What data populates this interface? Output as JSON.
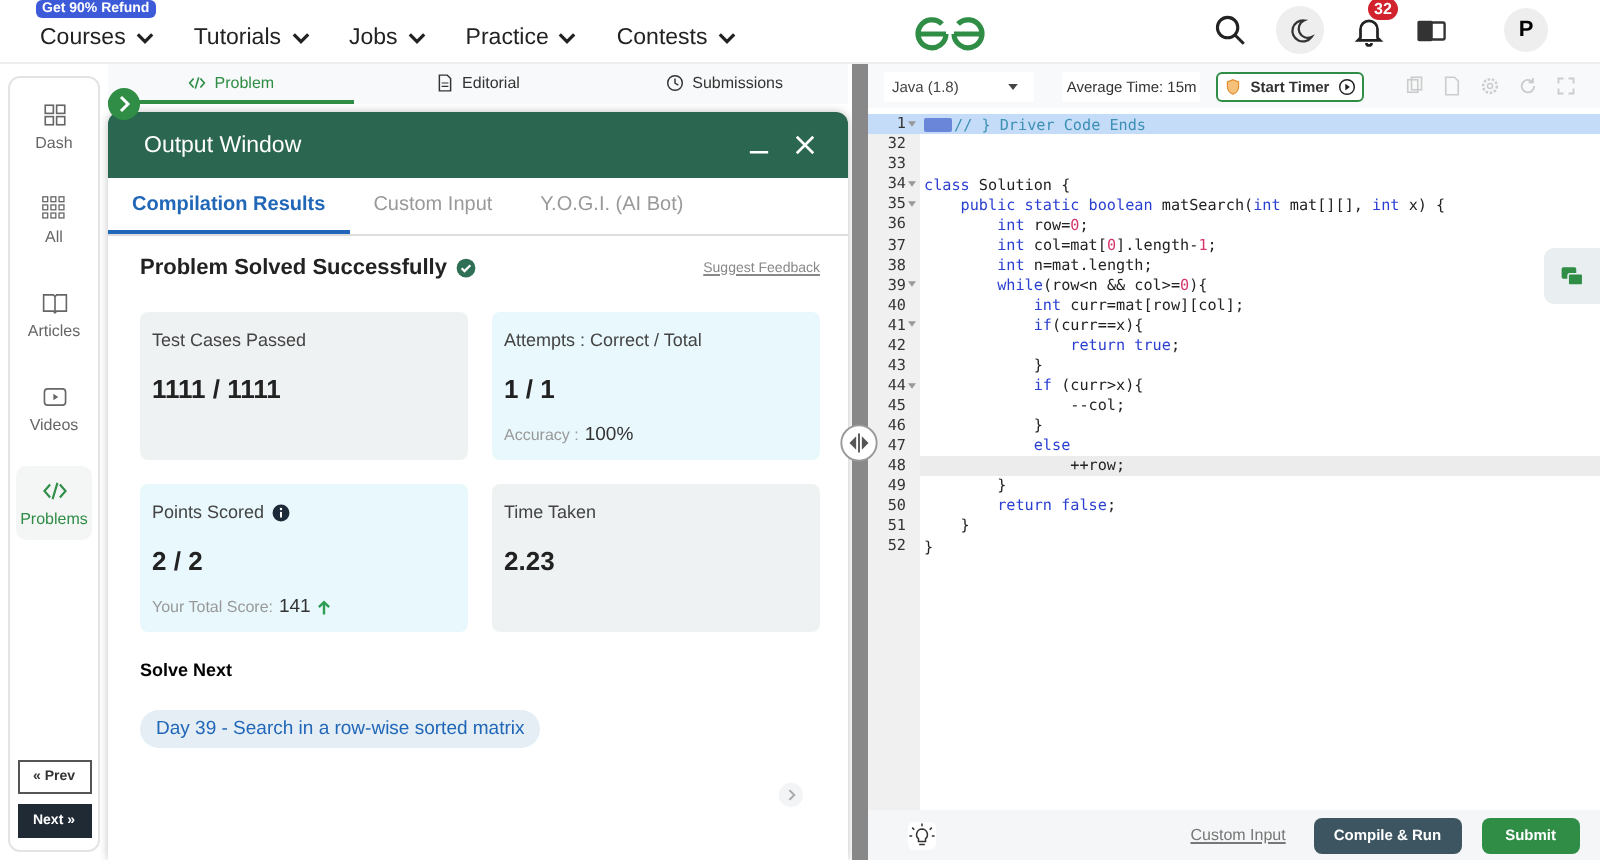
{
  "nav": {
    "promo_badge": "Get 90% Refund",
    "menu": [
      {
        "label": "Courses"
      },
      {
        "label": "Tutorials"
      },
      {
        "label": "Jobs"
      },
      {
        "label": "Practice"
      },
      {
        "label": "Contests"
      }
    ],
    "notification_count": "32",
    "avatar_letter": "P"
  },
  "sidebar": {
    "items": [
      {
        "label": "Dash",
        "selected": false
      },
      {
        "label": "All",
        "selected": false
      },
      {
        "label": "Articles",
        "selected": false
      },
      {
        "label": "Videos",
        "selected": false
      },
      {
        "label": "Problems",
        "selected": true
      }
    ],
    "prev": "« Prev",
    "next": "Next »"
  },
  "problem_tabs": [
    {
      "label": "Problem",
      "selected": true
    },
    {
      "label": "Editorial",
      "selected": false
    },
    {
      "label": "Submissions",
      "selected": false
    }
  ],
  "output_window": {
    "title": "Output Window",
    "tabs": [
      {
        "label": "Compilation Results",
        "selected": true
      },
      {
        "label": "Custom Input",
        "selected": false
      },
      {
        "label": "Y.O.G.I. (AI Bot)",
        "selected": false
      }
    ],
    "status": "Problem Solved Successfully",
    "feedback_link": "Suggest Feedback",
    "cards": [
      {
        "title": "Test Cases Passed",
        "value": "1111 / 1111",
        "color": "#eef2f2"
      },
      {
        "title": "Attempts : Correct / Total",
        "value": "1 / 1",
        "color": "#e8f8fc",
        "note_label": "Accuracy :",
        "note_value": "100%"
      },
      {
        "title": "Points Scored",
        "value": "2 / 2",
        "color": "#e8f8fc",
        "info_icon": true,
        "note_label": "Your Total Score:",
        "note_value": "141",
        "rising": true
      },
      {
        "title": "Time Taken",
        "value": "2.23",
        "color": "#eef2f2"
      }
    ],
    "solve_next_heading": "Solve Next",
    "solve_next": [
      "Day 39 - Search in a row-wise sorted matrix"
    ]
  },
  "editor": {
    "language": "Java (1.8)",
    "average_time": "Average Time: 15m",
    "timer_button": "Start Timer",
    "lines": [
      {
        "number": "1",
        "foldable": true,
        "selected": true,
        "folded": true,
        "segments": [
          {
            "kind": "comment",
            "text": "// } Driver Code Ends"
          }
        ]
      },
      {
        "number": "32",
        "foldable": false,
        "selected": false
      },
      {
        "number": "33",
        "foldable": false,
        "selected": false
      },
      {
        "number": "34",
        "foldable": true,
        "selected": false,
        "segments": [
          {
            "kind": "kw",
            "text": "class"
          },
          {
            "kind": "plain",
            "text": " Solution {"
          }
        ]
      },
      {
        "number": "35",
        "foldable": true,
        "selected": false,
        "segments": [
          {
            "kind": "kw",
            "text": "    public static boolean"
          },
          {
            "kind": "plain",
            "text": " matSearch("
          },
          {
            "kind": "kw",
            "text": "int"
          },
          {
            "kind": "plain",
            "text": " mat[][], "
          },
          {
            "kind": "kw",
            "text": "int"
          },
          {
            "kind": "plain",
            "text": " x) {"
          }
        ]
      },
      {
        "number": "36",
        "foldable": false,
        "selected": false,
        "segments": [
          {
            "kind": "kw",
            "text": "        int"
          },
          {
            "kind": "plain",
            "text": " row="
          },
          {
            "kind": "num",
            "text": "0"
          },
          {
            "kind": "plain",
            "text": ";"
          }
        ]
      },
      {
        "number": "37",
        "foldable": false,
        "selected": false,
        "segments": [
          {
            "kind": "kw",
            "text": "        int"
          },
          {
            "kind": "plain",
            "text": " col=mat["
          },
          {
            "kind": "num",
            "text": "0"
          },
          {
            "kind": "plain",
            "text": "].length-"
          },
          {
            "kind": "num",
            "text": "1"
          },
          {
            "kind": "plain",
            "text": ";"
          }
        ]
      },
      {
        "number": "38",
        "foldable": false,
        "selected": false,
        "segments": [
          {
            "kind": "kw",
            "text": "        int"
          },
          {
            "kind": "plain",
            "text": " n=mat.length;"
          }
        ]
      },
      {
        "number": "39",
        "foldable": true,
        "selected": false,
        "segments": [
          {
            "kind": "kw",
            "text": "        while"
          },
          {
            "kind": "plain",
            "text": "(row<n && col>="
          },
          {
            "kind": "num",
            "text": "0"
          },
          {
            "kind": "plain",
            "text": "){"
          }
        ]
      },
      {
        "number": "40",
        "foldable": false,
        "selected": false,
        "segments": [
          {
            "kind": "kw",
            "text": "            int"
          },
          {
            "kind": "plain",
            "text": " curr=mat[row][col];"
          }
        ]
      },
      {
        "number": "41",
        "foldable": true,
        "selected": false,
        "segments": [
          {
            "kind": "kw",
            "text": "            if"
          },
          {
            "kind": "plain",
            "text": "(curr==x){"
          }
        ]
      },
      {
        "number": "42",
        "foldable": false,
        "selected": false,
        "segments": [
          {
            "kind": "kw",
            "text": "                return true"
          },
          {
            "kind": "plain",
            "text": ";"
          }
        ]
      },
      {
        "number": "43",
        "foldable": false,
        "selected": false,
        "segments": [
          {
            "kind": "plain",
            "text": "            }"
          }
        ]
      },
      {
        "number": "44",
        "foldable": true,
        "selected": false,
        "segments": [
          {
            "kind": "kw",
            "text": "            if"
          },
          {
            "kind": "plain",
            "text": " (curr>x){"
          }
        ]
      },
      {
        "number": "45",
        "foldable": false,
        "selected": false,
        "segments": [
          {
            "kind": "plain",
            "text": "                --col;"
          }
        ]
      },
      {
        "number": "46",
        "foldable": false,
        "selected": false,
        "segments": [
          {
            "kind": "plain",
            "text": "            }"
          }
        ]
      },
      {
        "number": "47",
        "foldable": false,
        "selected": false,
        "segments": [
          {
            "kind": "kw",
            "text": "            else"
          }
        ]
      },
      {
        "number": "48",
        "foldable": false,
        "selected": false,
        "current": true,
        "segments": [
          {
            "kind": "plain",
            "text": "                ++row;"
          }
        ]
      },
      {
        "number": "49",
        "foldable": false,
        "selected": false,
        "segments": [
          {
            "kind": "plain",
            "text": "        }"
          }
        ]
      },
      {
        "number": "50",
        "foldable": false,
        "selected": false,
        "segments": [
          {
            "kind": "kw",
            "text": "        return false"
          },
          {
            "kind": "plain",
            "text": ";"
          }
        ]
      },
      {
        "number": "51",
        "foldable": false,
        "selected": false,
        "segments": [
          {
            "kind": "plain",
            "text": "    }"
          }
        ]
      },
      {
        "number": "52",
        "foldable": false,
        "selected": false,
        "segments": [
          {
            "kind": "plain",
            "text": "}"
          }
        ]
      }
    ],
    "custom_input_link": "Custom Input",
    "compile_button": "Compile & Run",
    "submit_button": "Submit"
  }
}
